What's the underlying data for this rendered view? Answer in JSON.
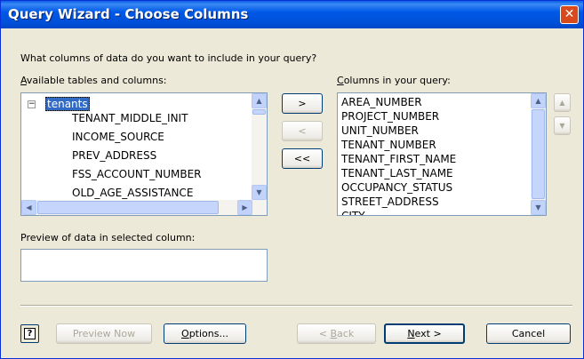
{
  "window": {
    "title": "Query Wizard - Choose Columns",
    "close_symbol": "✕"
  },
  "prompt": "What columns of data do you want to include in your query?",
  "available": {
    "label_prefix": "A",
    "label_rest": "vailable tables and columns:",
    "tree_toggle": "−",
    "table_name": "tenants",
    "columns": [
      "TENANT_MIDDLE_INIT",
      "INCOME_SOURCE",
      "PREV_ADDRESS",
      "FSS_ACCOUNT_NUMBER",
      "OLD_AGE_ASSISTANCE"
    ]
  },
  "move_buttons": {
    "add": ">",
    "remove": "<",
    "remove_all": "<<"
  },
  "selected": {
    "label_prefix": "C",
    "label_rest": "olumns in your query:",
    "columns": [
      "AREA_NUMBER",
      "PROJECT_NUMBER",
      "UNIT_NUMBER",
      "TENANT_NUMBER",
      "TENANT_FIRST_NAME",
      "TENANT_LAST_NAME",
      "OCCUPANCY_STATUS",
      "STREET_ADDRESS",
      "CITY"
    ]
  },
  "order": {
    "up": "▲",
    "down": "▼"
  },
  "preview": {
    "label": "Preview of data in selected column:",
    "value": ""
  },
  "footer": {
    "help_icon": "?",
    "preview_now": "Preview Now",
    "options_prefix": "O",
    "options_rest": "ptions...",
    "back_prefix": "< ",
    "back_underline": "B",
    "back_rest": "ack",
    "next_underline": "N",
    "next_rest": "ext >",
    "cancel": "Cancel"
  }
}
